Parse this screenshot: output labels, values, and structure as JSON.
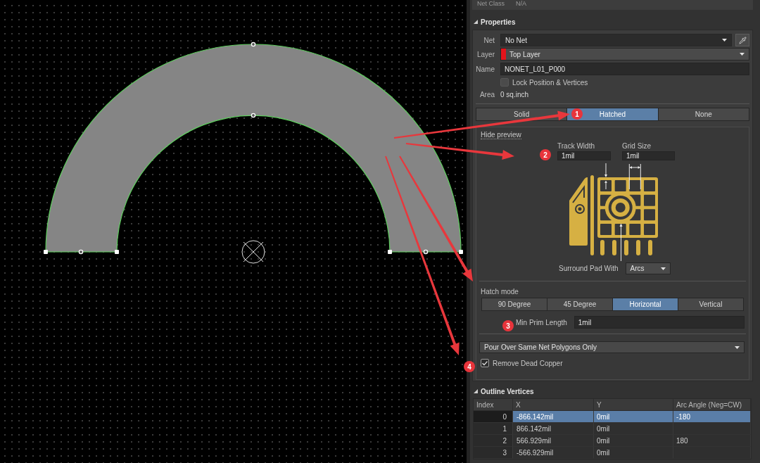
{
  "net_class": {
    "label": "Net Class",
    "value": "N/A"
  },
  "properties": {
    "title": "Properties",
    "expanded": true,
    "net": {
      "label": "Net",
      "value": "No Net"
    },
    "layer": {
      "label": "Layer",
      "value": "Top Layer"
    },
    "name": {
      "label": "Name",
      "value": "NONET_L01_P000"
    },
    "lock": {
      "label": "Lock Position & Vertices",
      "checked": false
    },
    "area": {
      "label": "Area",
      "value": "0 sq.inch"
    },
    "fill_modes": [
      {
        "label": "Solid",
        "selected": false
      },
      {
        "label": "Hatched",
        "selected": true
      },
      {
        "label": "None",
        "selected": false
      }
    ],
    "hatched": {
      "hide_preview": "Hide preview",
      "track_width": {
        "label": "Track Width",
        "value": "1mil"
      },
      "grid_size": {
        "label": "Grid Size",
        "value": "1mil"
      },
      "surround_pad": {
        "label": "Surround Pad With",
        "value": "Arcs"
      },
      "hatch_mode": {
        "label": "Hatch mode",
        "options": [
          {
            "label": "90 Degree",
            "selected": false
          },
          {
            "label": "45 Degree",
            "selected": false
          },
          {
            "label": "Horizontal",
            "selected": true
          },
          {
            "label": "Vertical",
            "selected": false
          }
        ]
      },
      "min_prim_length": {
        "label": "Min Prim Length",
        "value": "1mil"
      },
      "pour_over": {
        "value": "Pour Over Same Net Polygons Only"
      },
      "remove_dead_copper": {
        "label": "Remove Dead Copper",
        "checked": true
      }
    }
  },
  "outline_vertices": {
    "title": "Outline Vertices",
    "expanded": true,
    "columns": [
      "Index",
      "X",
      "Y",
      "Arc Angle (Neg=CW)"
    ],
    "rows": [
      {
        "index": "0",
        "x": "-866.142mil",
        "y": "0mil",
        "arc_angle": "-180",
        "selected": true
      },
      {
        "index": "1",
        "x": "866.142mil",
        "y": "0mil",
        "selected": false
      },
      {
        "index": "2",
        "x": "566.929mil",
        "y": "0mil",
        "arc_angle": "180",
        "selected": false
      },
      {
        "index": "3",
        "x": "-566.929mil",
        "y": "0mil",
        "selected": false
      }
    ]
  },
  "annotations": [
    {
      "label": "1"
    },
    {
      "label": "2"
    },
    {
      "label": "3"
    },
    {
      "label": "4"
    }
  ]
}
